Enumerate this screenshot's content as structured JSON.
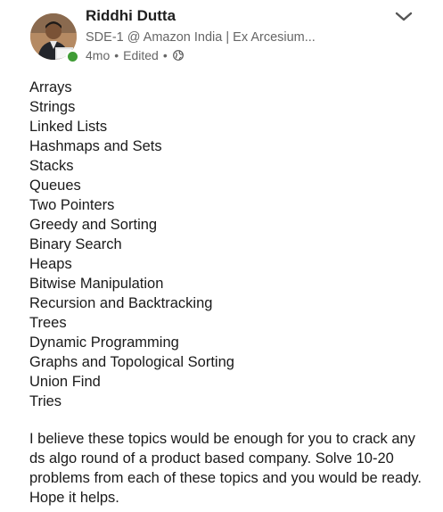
{
  "post": {
    "author": {
      "name": "Riddhi Dutta",
      "headline": "SDE-1 @ Amazon India | Ex Arcesium...",
      "time": "4mo",
      "edited": "Edited",
      "separator": "•",
      "visibility_icon": "globe-icon",
      "presence": "online",
      "presence_color": "#3f9c35"
    },
    "menu_icon": "chevron-down-icon",
    "topics": [
      "Arrays",
      "Strings",
      "Linked Lists",
      "Hashmaps and Sets",
      "Stacks",
      "Queues",
      "Two Pointers",
      "Greedy and Sorting",
      "Binary Search",
      "Heaps",
      "Bitwise Manipulation",
      "Recursion and Backtracking",
      "Trees",
      "Dynamic Programming",
      "Graphs and Topological Sorting",
      "Union Find",
      "Tries"
    ],
    "closing": "I believe these topics would be enough for you to crack any ds algo round of a product based company. Solve 10-20 problems from each of these topics and you would be ready. Hope it helps."
  }
}
